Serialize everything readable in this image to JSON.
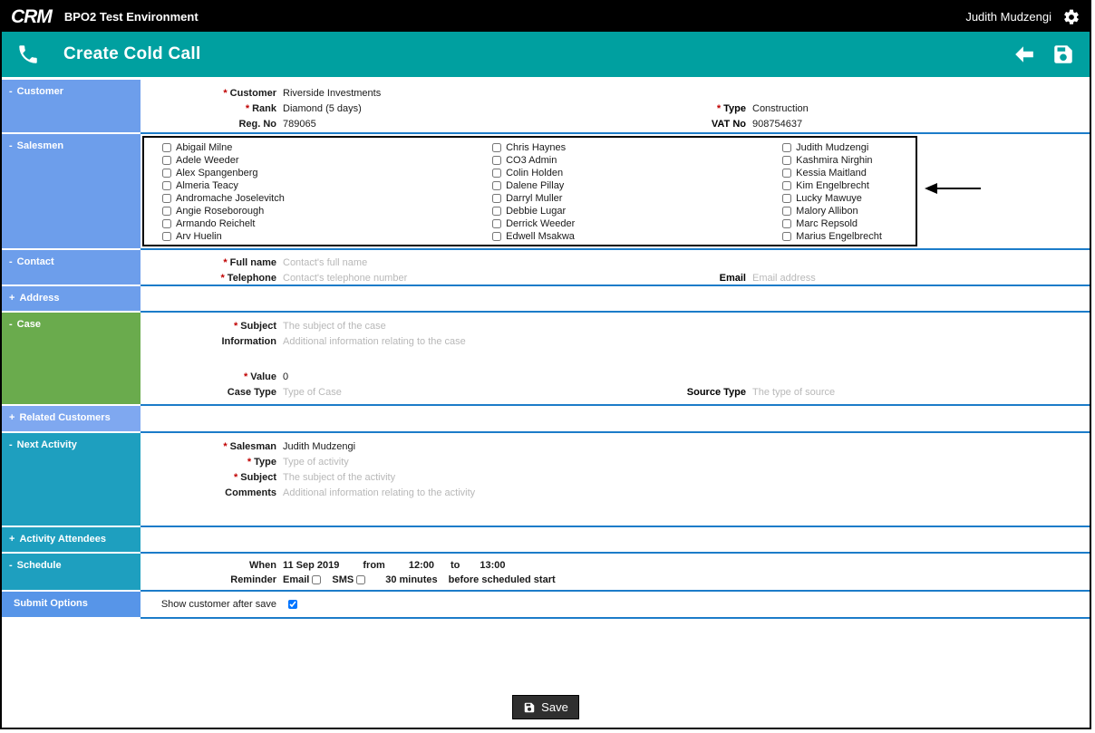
{
  "required_marker": "*",
  "top_bar": {
    "logo": "CRM",
    "app_title": "BPO2 Test Environment",
    "user_name": "Judith Mudzengi"
  },
  "page_header": {
    "title": "Create Cold Call"
  },
  "sidebar": {
    "items": [
      {
        "prefix": "-",
        "label": "Customer"
      },
      {
        "prefix": "-",
        "label": "Salesmen"
      },
      {
        "prefix": "-",
        "label": "Contact"
      },
      {
        "prefix": "+",
        "label": "Address"
      },
      {
        "prefix": "-",
        "label": "Case"
      },
      {
        "prefix": "+",
        "label": "Related Customers"
      },
      {
        "prefix": "-",
        "label": "Next Activity"
      },
      {
        "prefix": "+",
        "label": "Activity Attendees"
      },
      {
        "prefix": "-",
        "label": "Schedule"
      },
      {
        "prefix": "",
        "label": "Submit Options"
      }
    ]
  },
  "customer": {
    "customer_label": "Customer",
    "customer_value": "Riverside Investments",
    "rank_label": "Rank",
    "rank_value": "Diamond (5 days)",
    "regno_label": "Reg. No",
    "regno_value": "789065",
    "type_label": "Type",
    "type_value": "Construction",
    "vat_label": "VAT No",
    "vat_value": "908754637"
  },
  "salesmen": {
    "columns": [
      [
        "Abigail Milne",
        "Adele Weeder",
        "Alex Spangenberg",
        "Almeria Teacy",
        "Andromache Joselevitch",
        "Angie Roseborough",
        "Armando Reichelt",
        "Arv Huelin"
      ],
      [
        "Chris Haynes",
        "CO3 Admin",
        "Colin Holden",
        "Dalene Pillay",
        "Darryl Muller",
        "Debbie Lugar",
        "Derrick Weeder",
        "Edwell Msakwa"
      ],
      [
        "Judith Mudzengi",
        "Kashmira Nirghin",
        "Kessia Maitland",
        "Kim Engelbrecht",
        "Lucky Mawuye",
        "Malory Allibon",
        "Marc Repsold",
        "Marius Engelbrecht"
      ]
    ]
  },
  "contact": {
    "full_name_label": "Full name",
    "full_name_placeholder": "Contact's full name",
    "telephone_label": "Telephone",
    "telephone_placeholder": "Contact's telephone number",
    "email_label": "Email",
    "email_placeholder": "Email address"
  },
  "case": {
    "subject_label": "Subject",
    "subject_placeholder": "The subject of the case",
    "information_label": "Information",
    "information_placeholder": "Additional information relating to the case",
    "value_label": "Value",
    "value_value": "0",
    "case_type_label": "Case Type",
    "case_type_placeholder": "Type of Case",
    "source_type_label": "Source Type",
    "source_type_placeholder": "The type of source"
  },
  "next_activity": {
    "salesman_label": "Salesman",
    "salesman_value": "Judith Mudzengi",
    "type_label": "Type",
    "type_placeholder": "Type of activity",
    "subject_label": "Subject",
    "subject_placeholder": "The subject of the activity",
    "comments_label": "Comments",
    "comments_placeholder": "Additional information relating to the activity"
  },
  "schedule": {
    "when_label": "When",
    "when_date": "11 Sep 2019",
    "from_label": "from",
    "from_time": "12:00",
    "to_label": "to",
    "to_time": "13:00",
    "reminder_label": "Reminder",
    "email_label": "Email",
    "sms_label": "SMS",
    "minutes_value": "30 minutes",
    "before_label": "before scheduled start"
  },
  "submit_options": {
    "label": "Show customer after save",
    "checked": true
  },
  "footer": {
    "save_label": "Save"
  }
}
